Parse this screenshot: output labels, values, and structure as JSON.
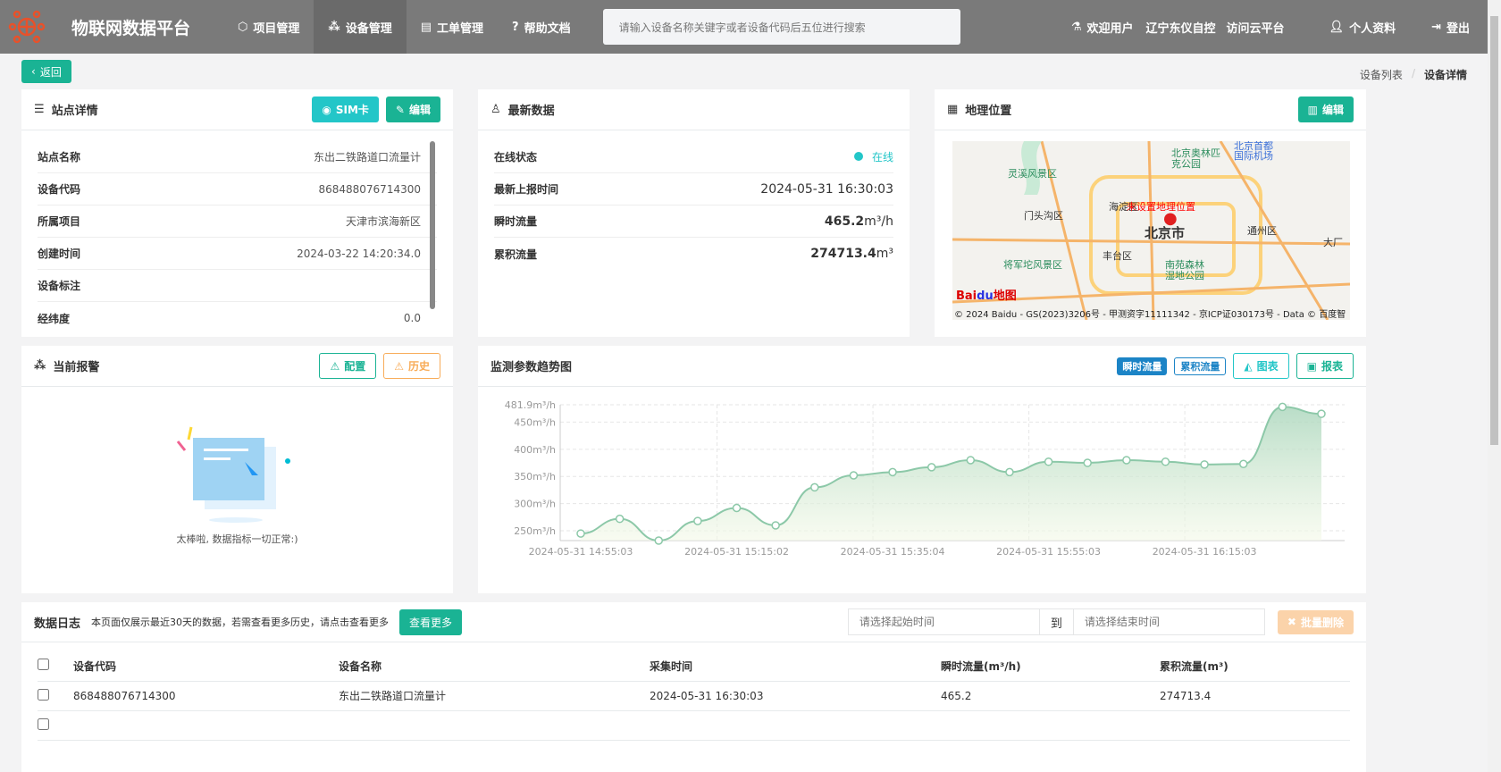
{
  "nav": {
    "brand": "物联网数据平台",
    "items": [
      {
        "label": "项目管理",
        "icon": "cube-icon"
      },
      {
        "label": "设备管理",
        "icon": "cubes-icon",
        "active": true
      },
      {
        "label": "工单管理",
        "icon": "file-icon"
      },
      {
        "label": "帮助文档",
        "icon": "question-icon"
      }
    ],
    "search_placeholder": "请输入设备名称关键字或者设备代码后五位进行搜索",
    "right": {
      "welcome": "欢迎用户",
      "company": "辽宁东仪自控",
      "cloud": "访问云平台",
      "profile": "个人资料",
      "logout": "登出"
    }
  },
  "back_label": "返回",
  "breadcrumb": {
    "list": "设备列表",
    "sep": "/",
    "current": "设备详情"
  },
  "site": {
    "title": "站点详情",
    "sim_label": "SIM卡",
    "edit_label": "编辑",
    "rows": [
      {
        "k": "站点名称",
        "v": "东出二铁路道口流量计"
      },
      {
        "k": "设备代码",
        "v": "868488076714300"
      },
      {
        "k": "所属项目",
        "v": "天津市滨海新区"
      },
      {
        "k": "创建时间",
        "v": "2024-03-22 14:20:34.0"
      },
      {
        "k": "设备标注",
        "v": ""
      },
      {
        "k": "经纬度",
        "v": "0.0"
      }
    ]
  },
  "latest": {
    "title": "最新数据",
    "status_label": "在线状态",
    "status": "在线",
    "report_label": "最新上报时间",
    "report_time": "2024-05-31 16:30:03",
    "flow_label": "瞬时流量",
    "flow": "465.2",
    "flow_unit": "m³/h",
    "total_label": "累积流量",
    "total": "274713.4",
    "total_unit": "m³",
    "status_color": "#23c6c8"
  },
  "geo": {
    "title": "地理位置",
    "edit_label": "编辑",
    "map_notice": "未设置地理位置",
    "city": "北京市",
    "labels": [
      "灵溪风景区",
      "北京奥林匹克公园",
      "门头沟区",
      "海淀区",
      "通州区",
      "丰台区",
      "将军坨风景区",
      "南苑森林湿地公园",
      "北京首都国际机场",
      "大厂"
    ],
    "copyright": "© 2024 Baidu - GS(2023)3206号 - 甲测资字11111342 - 京ICP证030173号 - Data © 百度智"
  },
  "alarm": {
    "title": "当前报警",
    "config_label": "配置",
    "history_label": "历史",
    "empty_text": "太棒啦, 数据指标一切正常:)"
  },
  "trend": {
    "title": "监测参数趋势图",
    "tabs": [
      "瞬时流量",
      "累积流量"
    ],
    "chart_label": "图表",
    "report_label": "报表"
  },
  "chart_data": {
    "type": "area",
    "ylabel_unit": "m³/h",
    "ylim": [
      232,
      481.9
    ],
    "yticks": [
      "250m³/h",
      "300m³/h",
      "350m³/h",
      "400m³/h",
      "450m³/h",
      "481.9m³/h"
    ],
    "ytick_values": [
      250,
      300,
      350,
      400,
      450,
      481.9
    ],
    "xtick_labels": [
      "2024-05-31 14:55:03",
      "2024-05-31 15:15:02",
      "2024-05-31 15:35:04",
      "2024-05-31 15:55:03",
      "2024-05-31 16:15:03"
    ],
    "xtick_index": [
      0,
      4,
      8,
      12,
      16
    ],
    "values": [
      245,
      272,
      232,
      268,
      292,
      260,
      330,
      352,
      358,
      367,
      380,
      358,
      377,
      375,
      380,
      377,
      372,
      373,
      478,
      465.2
    ],
    "grid": true,
    "color": "#8cc8a8"
  },
  "log": {
    "title": "数据日志",
    "note": "本页面仅展示最近30天的数据，若需查看更多历史，请点击查看更多",
    "more_label": "查看更多",
    "start_placeholder": "请选择起始时间",
    "to": "到",
    "end_placeholder": "请选择结束时间",
    "delete_label": "批量删除",
    "columns": [
      "设备代码",
      "设备名称",
      "采集时间",
      "瞬时流量(m³/h)",
      "累积流量(m³)"
    ],
    "rows": [
      [
        "868488076714300",
        "东出二铁路道口流量计",
        "2024-05-31 16:30:03",
        "465.2",
        "274713.4"
      ]
    ]
  }
}
